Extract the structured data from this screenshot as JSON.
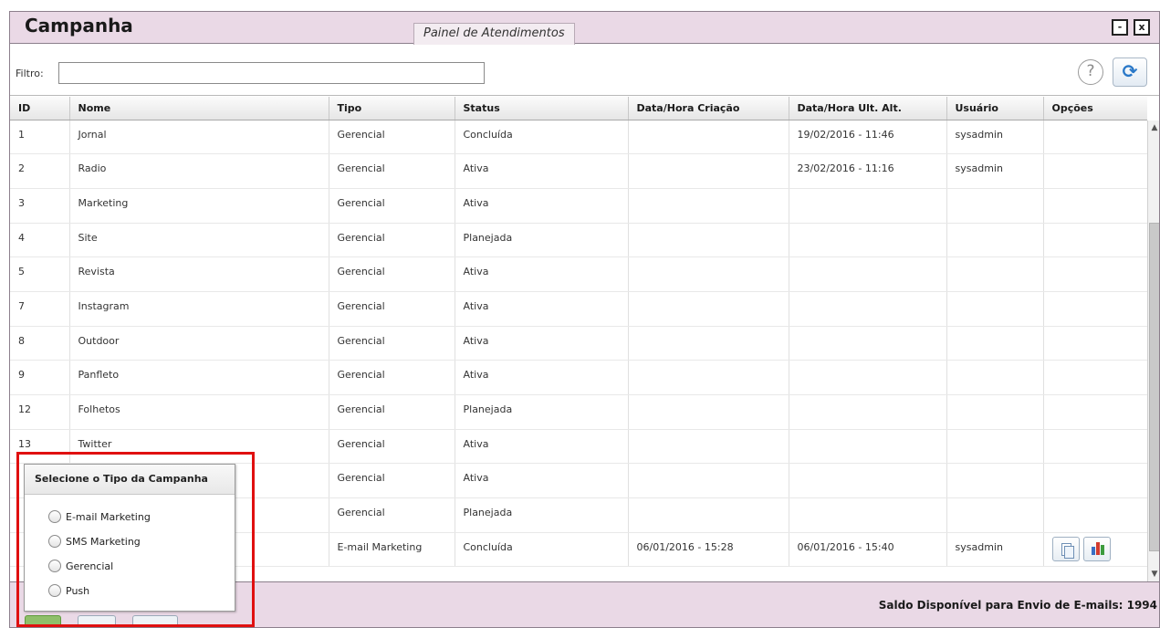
{
  "window": {
    "title": "Campanha",
    "panel_tab": "Painel de Atendimentos",
    "minimize_glyph": "-",
    "close_glyph": "x"
  },
  "filter": {
    "label": "Filtro:",
    "value": "",
    "help_glyph": "?",
    "refresh_glyph": "⟳"
  },
  "table": {
    "columns": [
      "ID",
      "Nome",
      "Tipo",
      "Status",
      "Data/Hora Criação",
      "Data/Hora Ult. Alt.",
      "Usuário",
      "Opções"
    ],
    "rows": [
      [
        "1",
        "Jornal",
        "Gerencial",
        "Concluída",
        "",
        "19/02/2016 - 11:46",
        "sysadmin"
      ],
      [
        "2",
        "Radio",
        "Gerencial",
        "Ativa",
        "",
        "23/02/2016 - 11:16",
        "sysadmin"
      ],
      [
        "3",
        "Marketing",
        "Gerencial",
        "Ativa",
        "",
        "",
        ""
      ],
      [
        "4",
        "Site",
        "Gerencial",
        "Planejada",
        "",
        "",
        ""
      ],
      [
        "5",
        "Revista",
        "Gerencial",
        "Ativa",
        "",
        "",
        ""
      ],
      [
        "7",
        "Instagram",
        "Gerencial",
        "Ativa",
        "",
        "",
        ""
      ],
      [
        "8",
        "Outdoor",
        "Gerencial",
        "Ativa",
        "",
        "",
        ""
      ],
      [
        "9",
        "Panfleto",
        "Gerencial",
        "Ativa",
        "",
        "",
        ""
      ],
      [
        "12",
        "Folhetos",
        "Gerencial",
        "Planejada",
        "",
        "",
        ""
      ],
      [
        "13",
        "Twitter",
        "Gerencial",
        "Ativa",
        "",
        "",
        ""
      ],
      [
        "",
        "",
        "Gerencial",
        "Ativa",
        "",
        "",
        ""
      ],
      [
        "",
        "",
        "Gerencial",
        "Planejada",
        "",
        "",
        ""
      ],
      [
        "",
        "",
        "E-mail Marketing",
        "Concluída",
        "06/01/2016 - 15:28",
        "06/01/2016 - 15:40",
        "sysadmin"
      ]
    ],
    "option_icons": [
      "copy-icon",
      "chart-icon"
    ]
  },
  "footer": {
    "saldo": "Saldo Disponível para Envio de E-mails: 1994"
  },
  "popup": {
    "title": "Selecione o Tipo da Campanha",
    "options": [
      "E-mail Marketing",
      "SMS Marketing",
      "Gerencial",
      "Push"
    ]
  },
  "colors": {
    "title_bar": "#ead9e6",
    "highlight": "#e01010",
    "refresh": "#2a78c8"
  }
}
